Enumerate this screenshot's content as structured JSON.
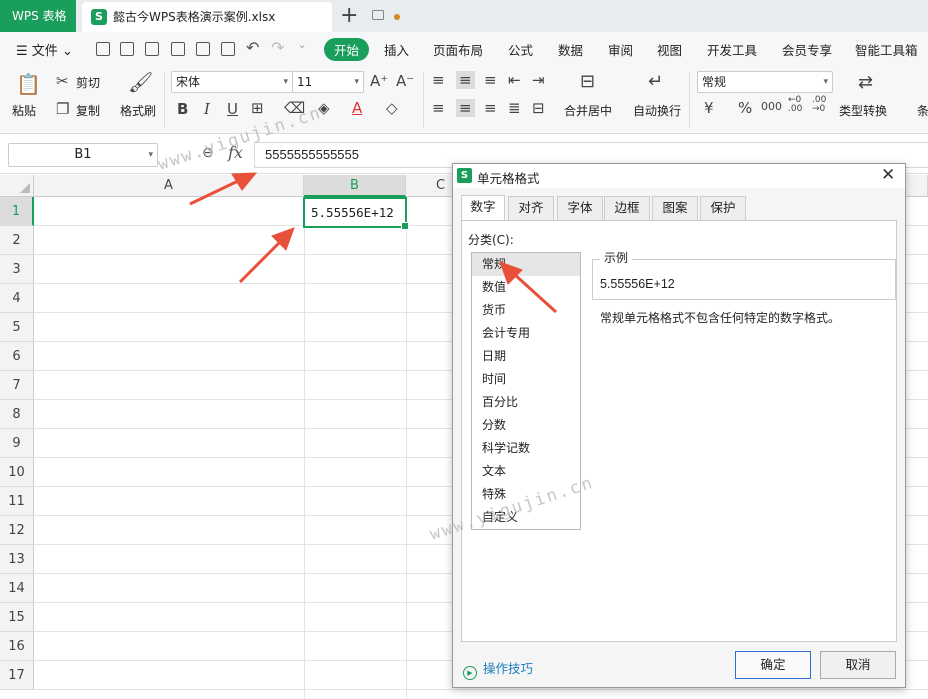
{
  "titlebar": {
    "app_tab": "WPS 表格",
    "doc_tab": "懿古今WPS表格演示案例.xlsx"
  },
  "menubar": {
    "file": "文件",
    "tabs": [
      "开始",
      "插入",
      "页面布局",
      "公式",
      "数据",
      "审阅",
      "视图",
      "开发工具",
      "会员专享",
      "智能工具箱"
    ]
  },
  "ribbon": {
    "paste": "粘贴",
    "cut": "剪切",
    "copy": "复制",
    "format_painter": "格式刷",
    "font_name": "宋体",
    "font_size": "11",
    "number_format": "常规",
    "merge_center": "合并居中",
    "wrap_text": "自动换行",
    "type_convert": "类型转换",
    "more": "条"
  },
  "formula": {
    "cell_ref": "B1",
    "fx": "fx",
    "value": "5555555555555"
  },
  "sheet": {
    "columns": [
      "A",
      "B",
      "C"
    ],
    "rows": [
      "1",
      "2",
      "3",
      "4",
      "5",
      "6",
      "7",
      "8",
      "9",
      "10",
      "11",
      "12",
      "13",
      "14",
      "15",
      "16",
      "17"
    ],
    "active_cell_text": "5.55556E+12"
  },
  "dialog": {
    "title": "单元格格式",
    "tabs": [
      "数字",
      "对齐",
      "字体",
      "边框",
      "图案",
      "保护"
    ],
    "category_label": "分类(C):",
    "categories": [
      "常规",
      "数值",
      "货币",
      "会计专用",
      "日期",
      "时间",
      "百分比",
      "分数",
      "科学记数",
      "文本",
      "特殊",
      "自定义"
    ],
    "sample_title": "示例",
    "sample_value": "5.55556E+12",
    "description": "常规单元格格式不包含任何特定的数字格式。",
    "tips": "操作技巧",
    "ok": "确定",
    "cancel": "取消"
  },
  "watermark": "www.yigujin.cn",
  "colors": {
    "accent": "#1a9e5b",
    "arrow": "#e8503a",
    "ok_border": "#2f6fd1"
  }
}
